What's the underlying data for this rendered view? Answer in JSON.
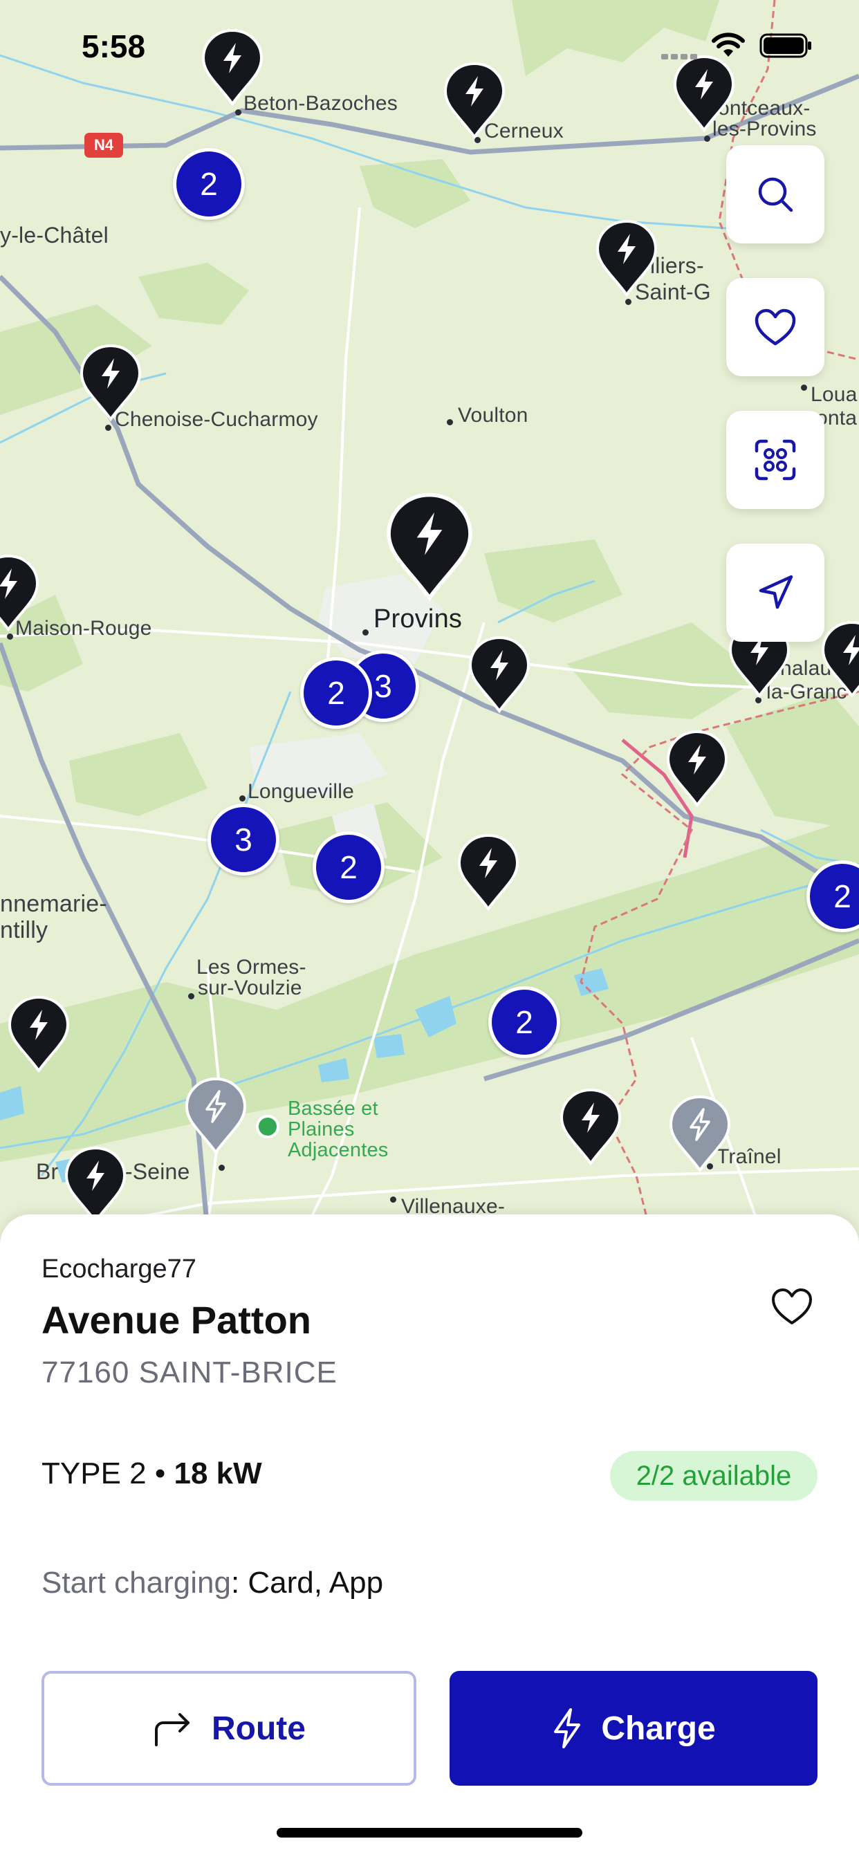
{
  "status_bar": {
    "time": "5:58"
  },
  "map": {
    "road_badge": "N4",
    "towns": {
      "beton_bazoches": "Beton-Bazoches",
      "cerneux": "Cerneux",
      "montceaux": "ontceaux-",
      "montceaux_2": "les-Provins",
      "chatel": "y-le-Châtel",
      "villiers": "lliers-",
      "villiers_2": "Saint-G",
      "chenoise": "Chenoise-Cucharmoy",
      "voulton": "Voulton",
      "loua": "Loua",
      "loua_2": "onta",
      "maison_rouge": "Maison-Rouge",
      "provins": "Provins",
      "chalau": "halau",
      "chalau_2": "la-Granc",
      "longueville": "Longueville",
      "annemarie": "nnemarie-",
      "annemarie_2": "ntilly",
      "ormes": "Les Ormes-",
      "ormes_2": "sur-Voulzie",
      "bassee": "Bassée et",
      "bassee_2": "Plaines",
      "bassee_3": "Adjacentes",
      "bray": "Br",
      "bray_2": "r-Seine",
      "trainel": "Traînel",
      "villenauxe": "Villenauxe-"
    },
    "clusters": [
      "2",
      "3",
      "2",
      "3",
      "2",
      "2",
      "2"
    ]
  },
  "fabs": [
    "search-icon",
    "heart-icon",
    "scan-icon",
    "locate-icon"
  ],
  "station": {
    "operator": "Ecocharge77",
    "name": "Avenue Patton",
    "address": "77160 SAINT-BRICE",
    "connector_type": "TYPE 2 • ",
    "power": "18 kW",
    "availability": "2/2 available",
    "start_label": "Start charging",
    "start_sep": ": ",
    "start_methods": "Card, App"
  },
  "actions": {
    "route_label": "Route",
    "charge_label": "Charge"
  },
  "colors": {
    "accent": "#1414b8",
    "available_bg": "#d7f6d6",
    "available_text": "#24a038",
    "pin": "#15171c",
    "pin_inactive": "#8e97a6"
  }
}
